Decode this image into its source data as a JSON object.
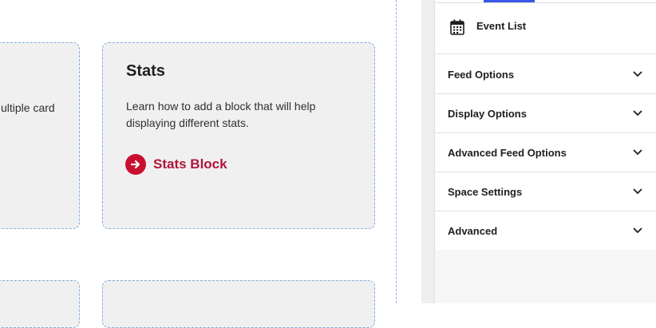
{
  "canvas": {
    "cards": [
      {
        "title": "",
        "description": "ultiple card"
      },
      {
        "title": "Stats",
        "description": "Learn how to add a block that will help displaying different stats.",
        "link_label": "Stats Block"
      }
    ],
    "accent_color": "#c8102e"
  },
  "sidebar": {
    "block": {
      "icon": "calendar-icon",
      "name": "Event List"
    },
    "panels": [
      {
        "label": "Feed Options"
      },
      {
        "label": "Display Options"
      },
      {
        "label": "Advanced Feed Options"
      },
      {
        "label": "Space Settings"
      },
      {
        "label": "Advanced"
      }
    ],
    "tab_indicator_color": "#3858e9"
  }
}
